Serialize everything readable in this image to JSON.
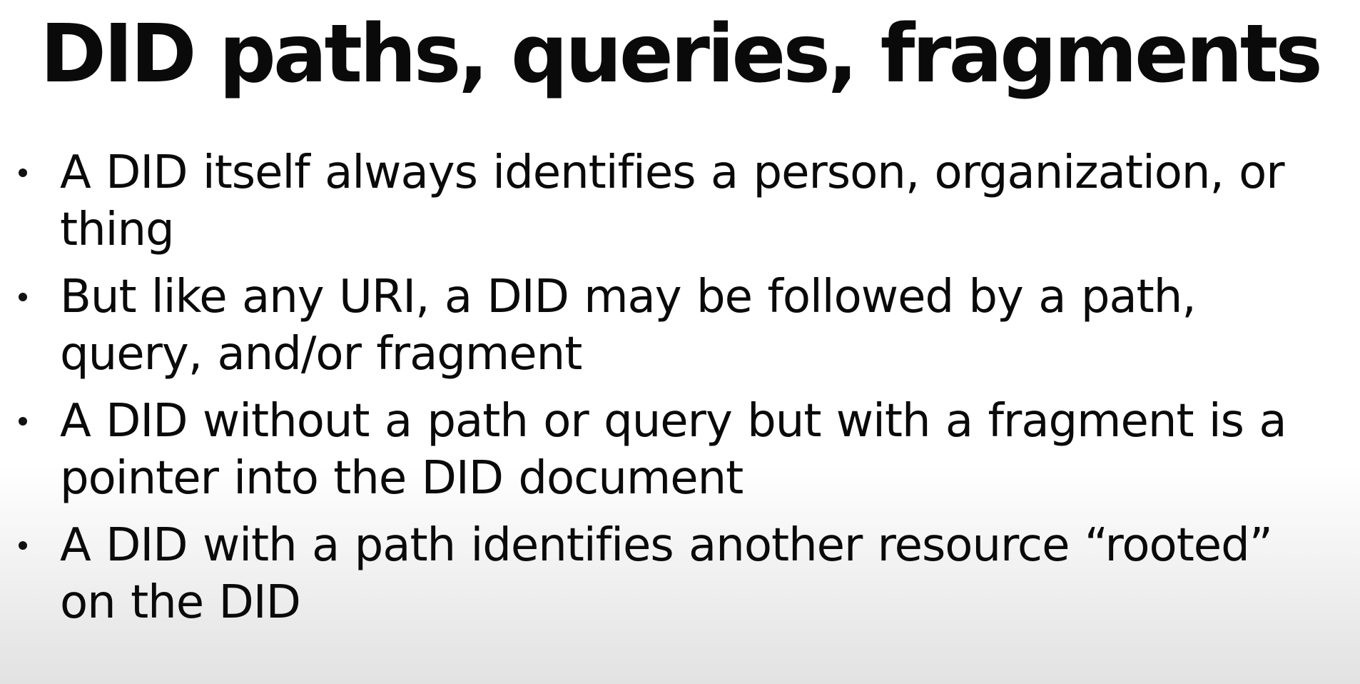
{
  "slide": {
    "title": "DID paths, queries, fragments",
    "bullets": [
      {
        "text": "A DID itself always identifies a person, organization, or thing"
      },
      {
        "text": "But like any URI, a DID may be followed by a path, query, and/or fragment"
      },
      {
        "text": "A DID without a path or query but with a fragment is a pointer into the DID document"
      },
      {
        "text": "A DID with a path identifies another resource “rooted” on the DID"
      }
    ]
  }
}
